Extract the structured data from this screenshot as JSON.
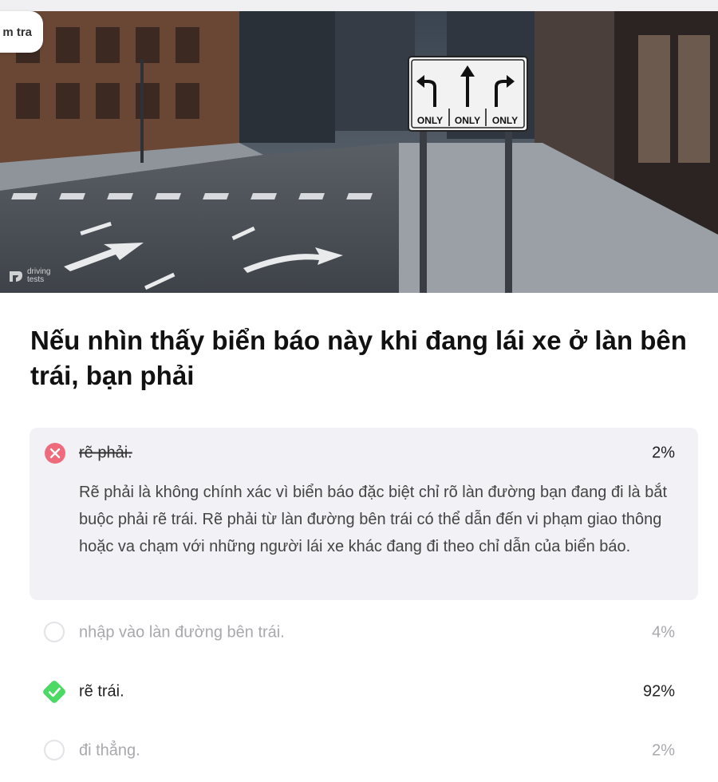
{
  "tab": {
    "label": "m tra"
  },
  "hero": {
    "sign_labels": [
      "ONLY",
      "ONLY",
      "ONLY"
    ],
    "watermark": "driving\ntests"
  },
  "question": "Nếu nhìn thấy biển báo này khi đang lái xe ở làn bên trái, bạn phải",
  "answers": [
    {
      "label": "rẽ phải.",
      "percent": "2%",
      "state": "selected-wrong",
      "explanation": "Rẽ phải là không chính xác vì biển báo đặc biệt chỉ rõ làn đường bạn đang đi là bắt buộc phải rẽ trái. Rẽ phải từ làn đường bên trái có thể dẫn đến vi phạm giao thông hoặc va chạm với những người lái xe khác đang đi theo chỉ dẫn của biển báo."
    },
    {
      "label": "nhập vào làn đường bên trái.",
      "percent": "4%",
      "state": "unselected"
    },
    {
      "label": "rẽ trái.",
      "percent": "92%",
      "state": "correct"
    },
    {
      "label": "đi thẳng.",
      "percent": "2%",
      "state": "unselected"
    }
  ],
  "colors": {
    "wrong": "#ef6b7b",
    "correct": "#4cd964",
    "panel": "#f2f1f6"
  },
  "icons": [
    "close-icon",
    "check-icon",
    "radio-empty-icon"
  ]
}
